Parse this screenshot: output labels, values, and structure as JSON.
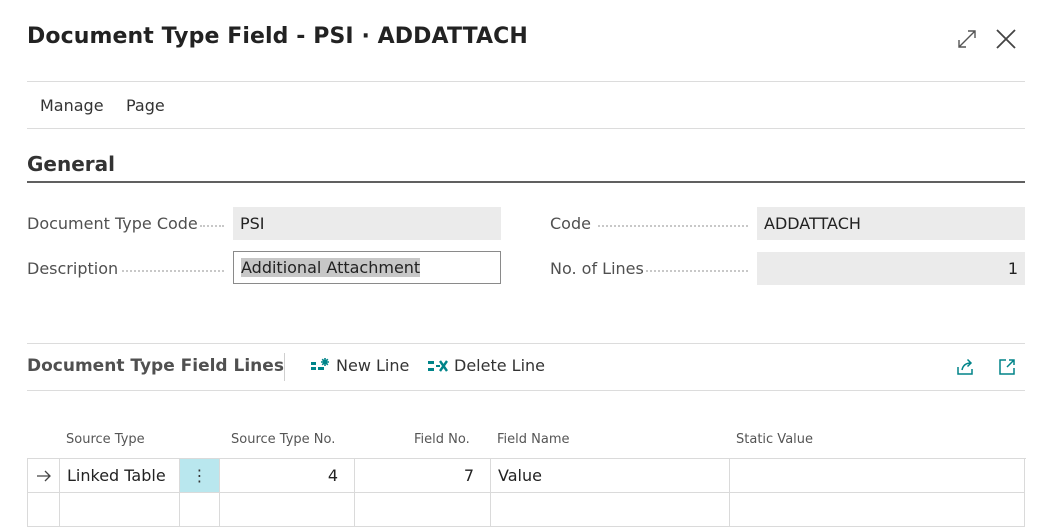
{
  "header": {
    "title": "Document Type Field - PSI · ADDATTACH",
    "expand_icon": "expand-icon",
    "close_icon": "close-icon"
  },
  "menu": [
    "Manage",
    "Page"
  ],
  "general": {
    "title": "General",
    "fields": {
      "doc_type_code": {
        "label": "Document Type Code",
        "value": "PSI"
      },
      "description": {
        "label": "Description",
        "value": "Additional Attachment"
      },
      "code": {
        "label": "Code",
        "value": "ADDATTACH"
      },
      "no_of_lines": {
        "label": "No. of Lines",
        "value": "1"
      }
    }
  },
  "lines": {
    "title": "Document Type Field Lines",
    "actions": {
      "new_line": "New Line",
      "delete_line": "Delete Line"
    },
    "share_icon": "share-icon",
    "open_icon": "open-in-new-icon",
    "columns": [
      "Source Type",
      "Source Type No.",
      "Field No.",
      "Field Name",
      "Static Value"
    ],
    "rows": [
      {
        "source_type": "Linked Table",
        "source_type_no": "4",
        "field_no": "7",
        "field_name": "Value",
        "static_value": ""
      }
    ]
  },
  "colors": {
    "accent": "#008489",
    "row_menu_bg": "#b9e7ee"
  }
}
